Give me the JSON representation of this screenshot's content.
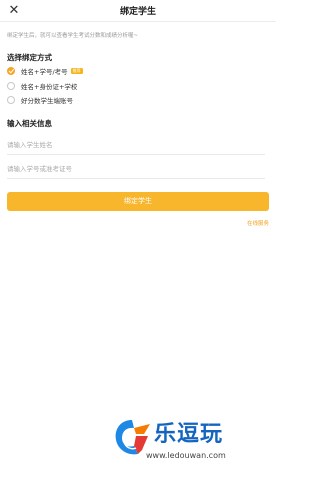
{
  "header": {
    "title": "绑定学生",
    "close_icon": "close-icon"
  },
  "intro_text": "绑定学生后，就可以查看学生考试分数和成绩分析喔~",
  "bind_method": {
    "title": "选择绑定方式",
    "options": [
      {
        "label": "姓名+学号/考号",
        "badge": "推荐",
        "selected": true
      },
      {
        "label": "姓名+身份证+学校",
        "selected": false
      },
      {
        "label": "好分数学生端账号",
        "selected": false
      }
    ]
  },
  "info": {
    "title": "输入相关信息",
    "name_placeholder": "请输入学生姓名",
    "id_placeholder": "请输入学号或准考证号"
  },
  "submit_label": "绑定学生",
  "online_service_label": "在线服务",
  "watermark": {
    "name": "乐逗玩",
    "url": "www.ledouwan.com"
  },
  "colors": {
    "accent": "#f8b62d",
    "link": "#f0a020",
    "watermark_blue": "#1565c0"
  }
}
